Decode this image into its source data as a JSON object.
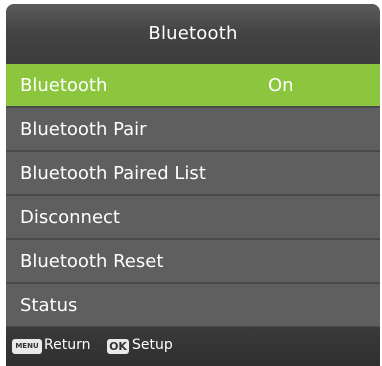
{
  "header": {
    "title": "Bluetooth"
  },
  "menu": {
    "items": [
      {
        "label": "Bluetooth",
        "value": "On"
      },
      {
        "label": "Bluetooth Pair"
      },
      {
        "label": "Bluetooth Paired List"
      },
      {
        "label": "Disconnect"
      },
      {
        "label": "Bluetooth Reset"
      },
      {
        "label": "Status"
      }
    ],
    "selected_index": 0
  },
  "footer": {
    "menu_key": "MENU",
    "return_label": "Return",
    "ok_key": "OK",
    "setup_label": "Setup"
  },
  "colors": {
    "selected_bg": "#8cc63f",
    "item_bg": "#5f5f5f",
    "panel_bg": "#4a4a4a"
  }
}
